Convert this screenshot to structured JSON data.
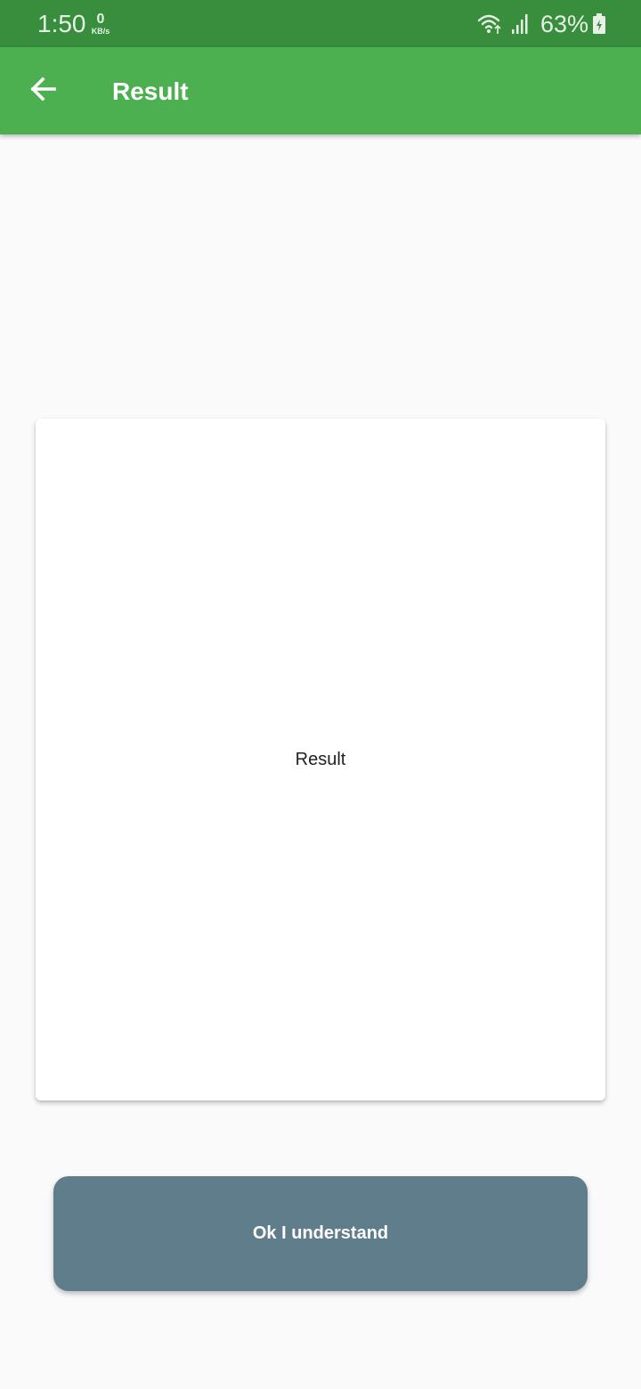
{
  "status_bar": {
    "time": "1:50",
    "net_speed_value": "0",
    "net_speed_unit": "KB/s",
    "battery_percent": "63%",
    "icons": [
      "wifi-icon",
      "signal-icon",
      "battery-charging-icon"
    ]
  },
  "app_bar": {
    "title": "Result",
    "back_icon": "arrow-back-icon",
    "color": "#4caf50",
    "status_color": "#388e3c"
  },
  "card": {
    "text": "Result"
  },
  "button": {
    "label": "Ok I understand",
    "color": "#607d8b"
  }
}
